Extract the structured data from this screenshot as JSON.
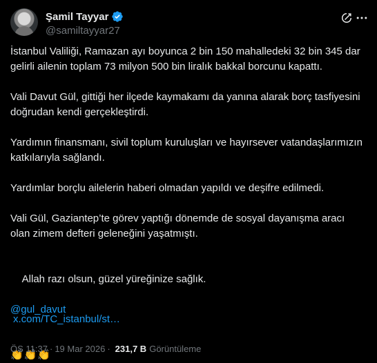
{
  "author": {
    "display_name": "Şamil Tayyar",
    "handle": "@samiltayyar27"
  },
  "icons": {
    "verified": "verified-badge-icon",
    "grok": "grok-icon",
    "more": "more-options-icon"
  },
  "colors": {
    "background": "#000000",
    "text": "#e7e9ea",
    "secondary": "#71767b",
    "accent": "#1d9bf0"
  },
  "tweet": {
    "paragraphs": [
      "İstanbul Valiliği, Ramazan ayı boyunca 2 bin 150 mahalledeki 32 bin 345 dar gelirli ailenin toplam 73 milyon 500 bin liralık bakkal borcunu kapattı.",
      "Vali Davut Gül, gittiği her ilçede kaymakamı da yanına alarak borç tasfiyesini doğrudan kendi gerçekleştirdi.",
      "Yardımın finansmanı, sivil toplum kuruluşları ve hayırsever vatandaşlarımızın katkılarıyla sağlandı.",
      "Yardımlar borçlu ailelerin haberi olmadan yapıldı ve deşifre edilmedi.",
      "Vali Gül, Gaziantep’te görev yaptığı dönemde de sosyal dayanışma aracı olan zimem defteri geleneğini yaşatmıştı."
    ],
    "closing": "Allah razı olsun, güzel yüreğinize sağlık.",
    "mention": "@gul_davut",
    "emojis": [
      "👏",
      "👏",
      "👏"
    ],
    "link": "x.com/TC_istanbul/st…"
  },
  "meta": {
    "time": "ÖS 11:37",
    "separator": "·",
    "date": "19 Mar 2026",
    "separator2": "·",
    "views_count": "231,7 B",
    "views_label": "Görüntüleme"
  }
}
